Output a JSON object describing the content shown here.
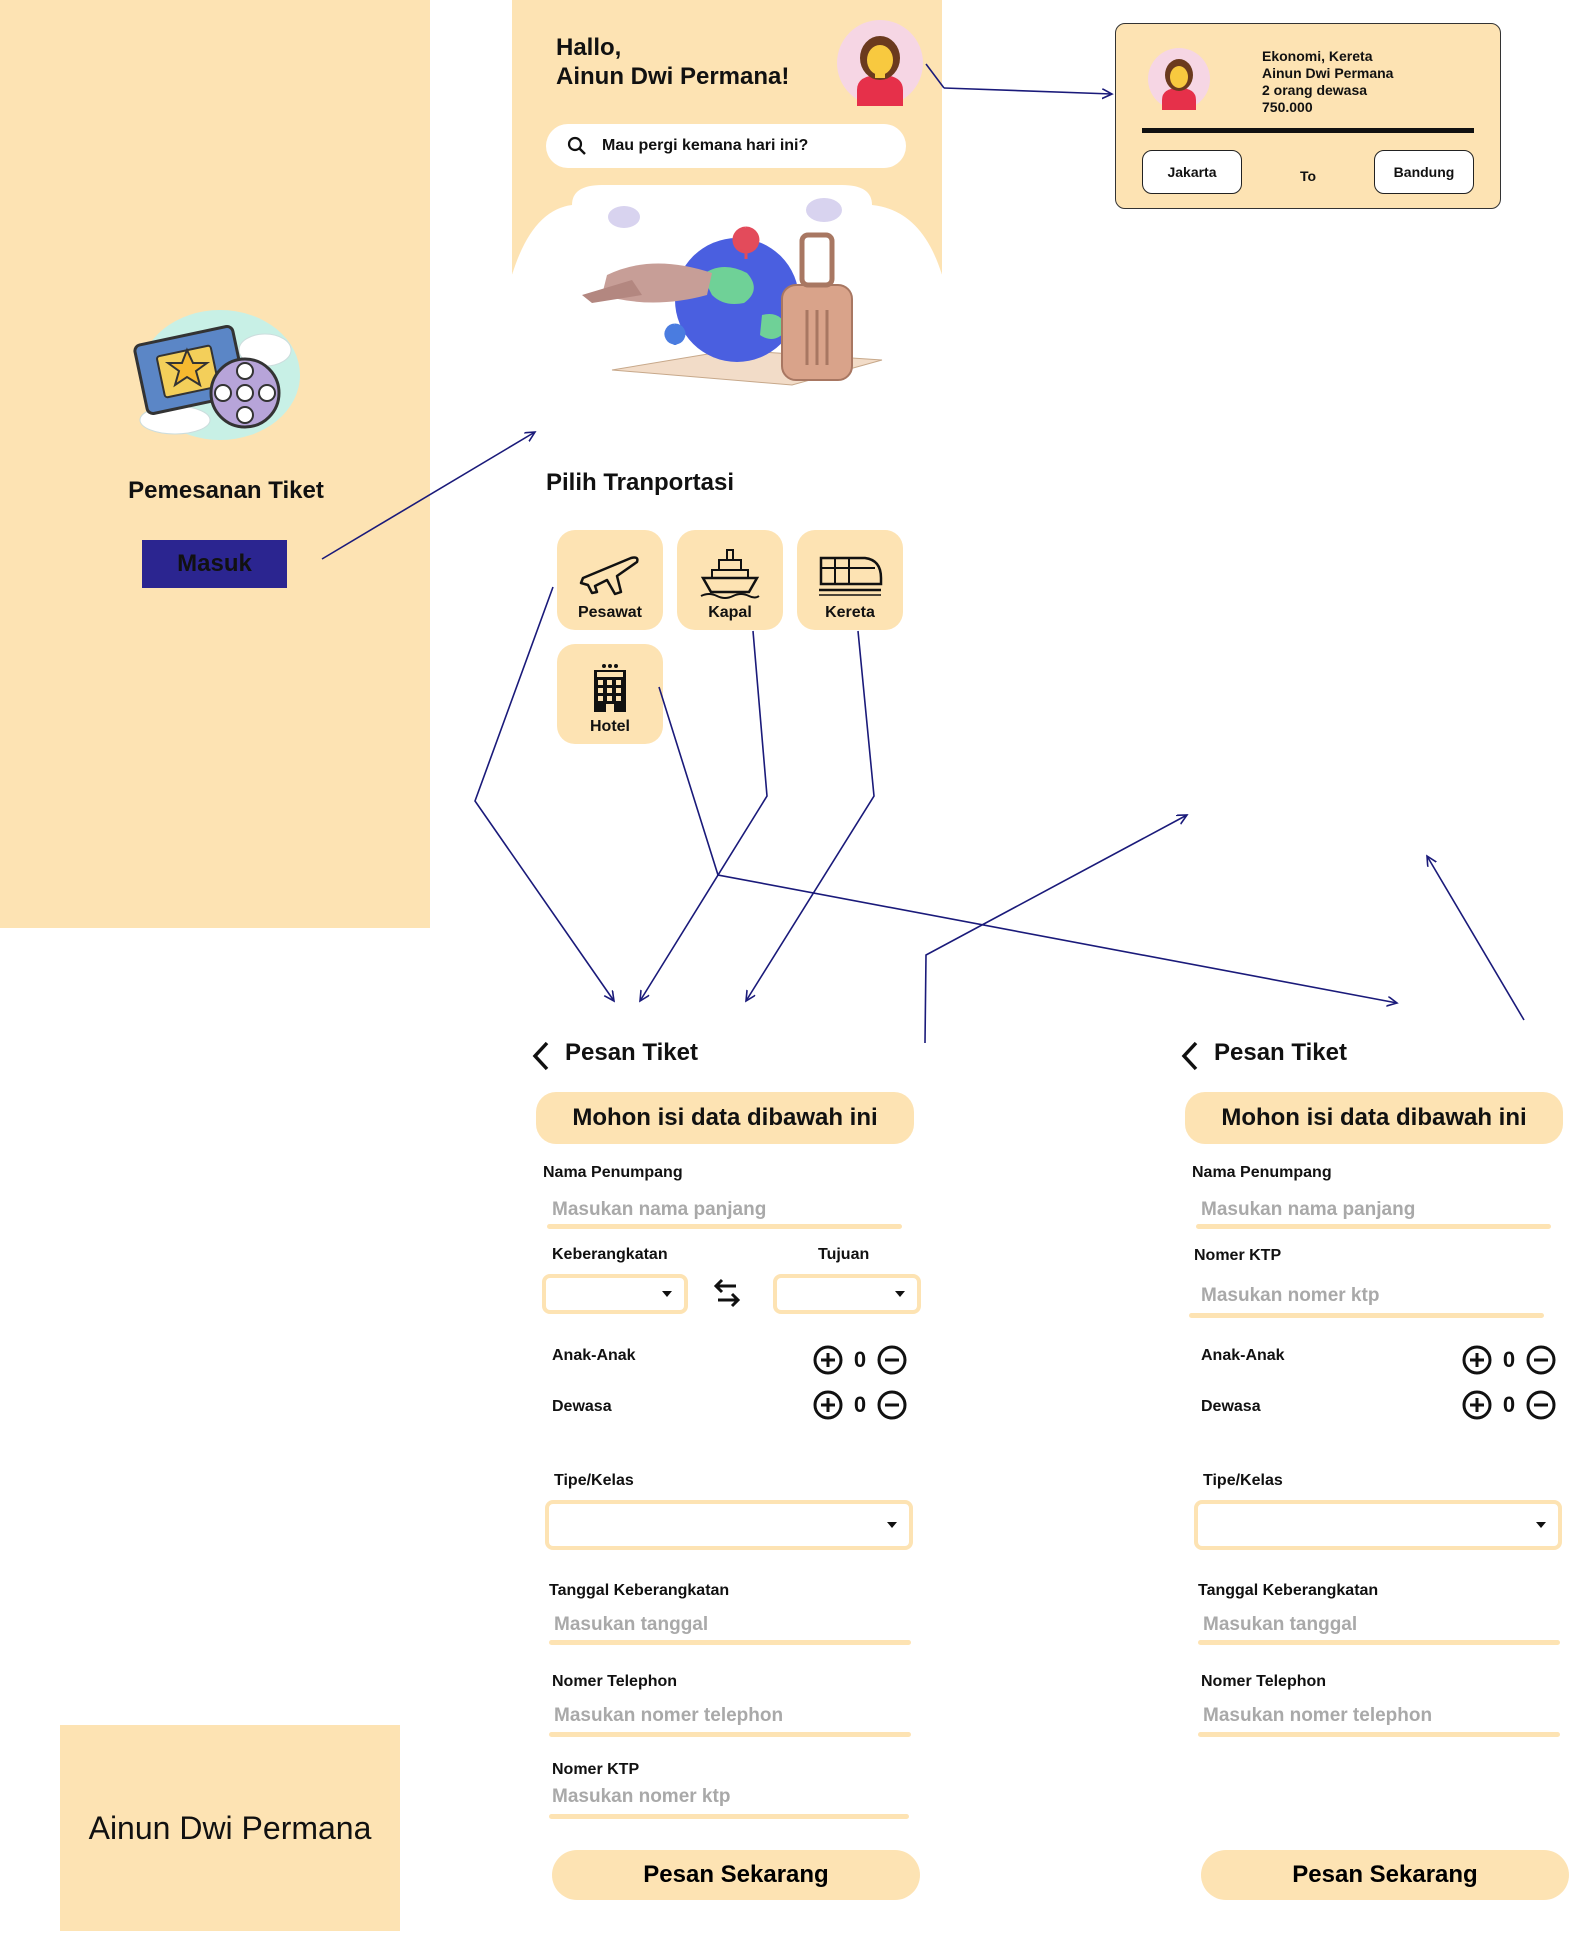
{
  "splash": {
    "title": "Pemesanan Tiket",
    "login_label": "Masuk"
  },
  "home": {
    "greeting_line1": "Hallo,",
    "greeting_line2": "Ainun Dwi Permana!",
    "search_placeholder": "Mau pergi kemana hari ini?",
    "section_title": "Pilih Tranportasi",
    "transports": [
      {
        "label": "Pesawat",
        "icon": "airplane-icon"
      },
      {
        "label": "Kapal",
        "icon": "ship-icon"
      },
      {
        "label": "Kereta",
        "icon": "train-icon"
      },
      {
        "label": "Hotel",
        "icon": "hotel-icon"
      }
    ]
  },
  "ticket": {
    "line1": "Ekonomi, Kereta",
    "line2": "Ainun Dwi Permana",
    "line3": "2 orang dewasa",
    "line4": "750.000",
    "from": "Jakarta",
    "to_label": "To",
    "to": "Bandung"
  },
  "name_card": {
    "text": "Ainun Dwi Permana"
  },
  "form_transport": {
    "back_title": "Pesan Tiket",
    "banner": "Mohon isi data dibawah ini",
    "name_label": "Nama Penumpang",
    "name_placeholder": "Masukan nama panjang",
    "depart_label": "Keberangkatan",
    "dest_label": "Tujuan",
    "children_label": "Anak-Anak",
    "children_count": "0",
    "adult_label": "Dewasa",
    "adult_count": "0",
    "class_label": "Tipe/Kelas",
    "date_label": "Tanggal Keberangkatan",
    "date_placeholder": "Masukan tanggal",
    "phone_label": "Nomer Telephon",
    "phone_placeholder": "Masukan nomer telephon",
    "ktp_label": "Nomer KTP",
    "ktp_placeholder": "Masukan nomer ktp",
    "submit_label": "Pesan Sekarang"
  },
  "form_hotel": {
    "back_title": "Pesan Tiket",
    "banner": "Mohon isi data dibawah ini",
    "name_label": "Nama Penumpang",
    "name_placeholder": "Masukan nama panjang",
    "ktp_label": "Nomer KTP",
    "ktp_placeholder": "Masukan nomer ktp",
    "children_label": "Anak-Anak",
    "children_count": "0",
    "adult_label": "Dewasa",
    "adult_count": "0",
    "class_label": "Tipe/Kelas",
    "date_label": "Tanggal Keberangkatan",
    "date_placeholder": "Masukan tanggal",
    "phone_label": "Nomer Telephon",
    "phone_placeholder": "Masukan nomer telephon",
    "submit_label": "Pesan Sekarang"
  },
  "colors": {
    "panel": "#fde3b3",
    "button": "#2b2590",
    "arrow": "#1a1a7a",
    "placeholder": "#a9a9a9"
  }
}
